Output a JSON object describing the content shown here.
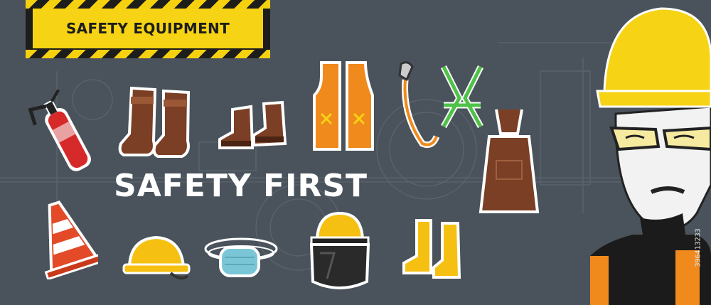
{
  "banner": {
    "title": "SAFETY EQUIPMENT"
  },
  "headline": {
    "text": "SAFETY FIRST"
  },
  "stock": {
    "id": "396413233"
  },
  "equipment": [
    "fire-extinguisher",
    "tall-boots",
    "ankle-boots",
    "safety-vest",
    "lanyard",
    "safety-harness",
    "leather-apron",
    "traffic-cone",
    "hard-hat",
    "face-mask",
    "face-shield-helmet",
    "rubber-boots"
  ],
  "colors": {
    "background": "#4a535c",
    "accent_yellow": "#f6d314",
    "stripe_black": "#1d1d1b",
    "text_white": "#ffffff"
  }
}
